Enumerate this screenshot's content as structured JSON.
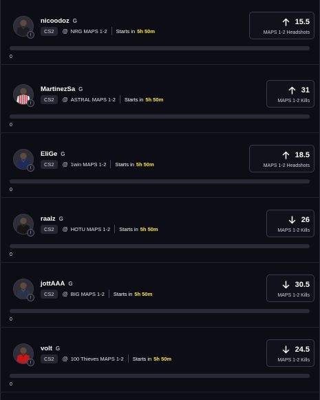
{
  "colors": {
    "background": "#0d0d16",
    "highlight_time": "#ffe838",
    "chip_bg": "#262633",
    "box_border": "#3a3a4c"
  },
  "cards": [
    {
      "player": "nicoodoz",
      "tier": "G",
      "game": "CS2",
      "match": "NRG MAPS 1-2",
      "starts_label": "Starts in",
      "starts_time": "5h 50m",
      "direction": "up",
      "value": "15.5",
      "stat": "MAPS 1-2 Headshots",
      "avatar": "dark-jersey",
      "progress": 0,
      "count": "0"
    },
    {
      "player": "MartinezSa",
      "tier": "G",
      "game": "CS2",
      "match": "ASTRAL MAPS 1-2",
      "starts_label": "Starts in",
      "starts_time": "5h 50m",
      "direction": "up",
      "value": "31",
      "stat": "MAPS 1-2 Kills",
      "avatar": "striped-jersey",
      "progress": 0,
      "count": "0"
    },
    {
      "player": "EliGe",
      "tier": "G",
      "game": "CS2",
      "match": "1win MAPS 1-2",
      "starts_label": "Starts in",
      "starts_time": "5h 50m",
      "direction": "up",
      "value": "18.5",
      "stat": "MAPS 1-2 Headshots",
      "avatar": "navy-jersey",
      "progress": 0,
      "count": "0"
    },
    {
      "player": "raalz",
      "tier": "G",
      "game": "CS2",
      "match": "HOTU MAPS 1-2",
      "starts_label": "Starts in",
      "starts_time": "5h 50m",
      "direction": "down",
      "value": "26",
      "stat": "MAPS 1-2 Kills",
      "avatar": "black-jersey",
      "progress": 0,
      "count": "0"
    },
    {
      "player": "jottAAA",
      "tier": "G",
      "game": "CS2",
      "match": "BIG MAPS 1-2",
      "starts_label": "Starts in",
      "starts_time": "5h 50m",
      "direction": "down",
      "value": "30.5",
      "stat": "MAPS 1-2 Kills",
      "avatar": "slate-jersey",
      "progress": 0,
      "count": "0"
    },
    {
      "player": "volt",
      "tier": "G",
      "game": "CS2",
      "match": "100 Thieves MAPS 1-2",
      "starts_label": "Starts in",
      "starts_time": "5h 50m",
      "direction": "down",
      "value": "24.5",
      "stat": "MAPS 1-2 Kills",
      "avatar": "red-jersey",
      "progress": 0,
      "count": "0"
    }
  ]
}
